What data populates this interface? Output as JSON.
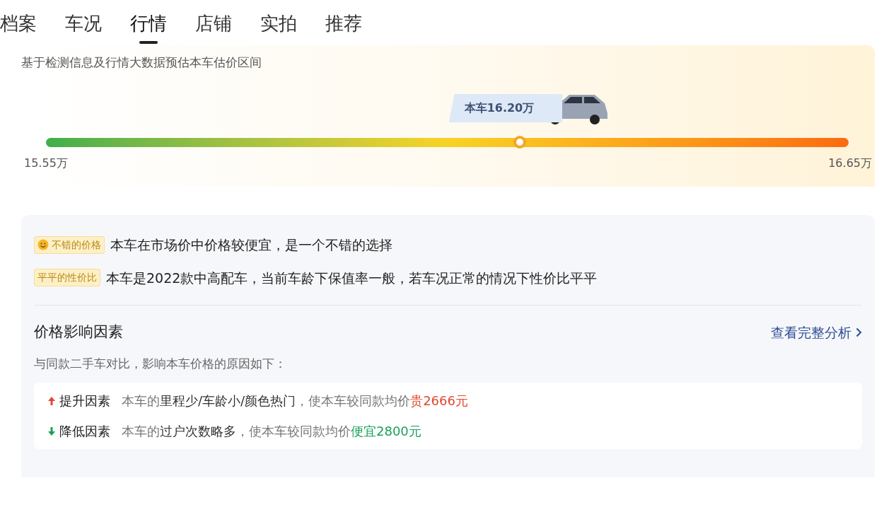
{
  "tabs": [
    {
      "label": "档案",
      "selected": false
    },
    {
      "label": "车况",
      "selected": false
    },
    {
      "label": "行情",
      "selected": true
    },
    {
      "label": "店铺",
      "selected": false
    },
    {
      "label": "实拍",
      "selected": false
    },
    {
      "label": "推荐",
      "selected": false
    }
  ],
  "estimate": {
    "caption": "基于检测信息及行情大数据预估本车估价区间",
    "current_price": "本车16.20万",
    "level": 0.59,
    "min_label": "15.55万",
    "max_label": "16.65万"
  },
  "verdicts": [
    {
      "badge": "不错的价格",
      "emoji": true,
      "text": "本车在市场价中价格较便宜，是一个不错的选择"
    },
    {
      "badge": "平平的性价比",
      "emoji": false,
      "text": "本车是2022款中高配车，当前车龄下保值率一般，若车况正常的情况下性价比平平"
    }
  ],
  "factors": {
    "title": "价格影响因素",
    "link": "查看完整分析",
    "subtitle": "与同款二手车对比，影响本车价格的原因如下：",
    "items": [
      {
        "kind": "up",
        "label": "提升因素",
        "prefix": "本车的",
        "highlight": "里程少/车龄小/颜色热门",
        "middle": "，使本车较同款均价",
        "amount": "贵2666元"
      },
      {
        "kind": "down",
        "label": "降低因素",
        "prefix": "本车的",
        "highlight": "过户次数略多",
        "middle": "，使本车较同款均价",
        "amount": "便宜2800元"
      }
    ]
  }
}
